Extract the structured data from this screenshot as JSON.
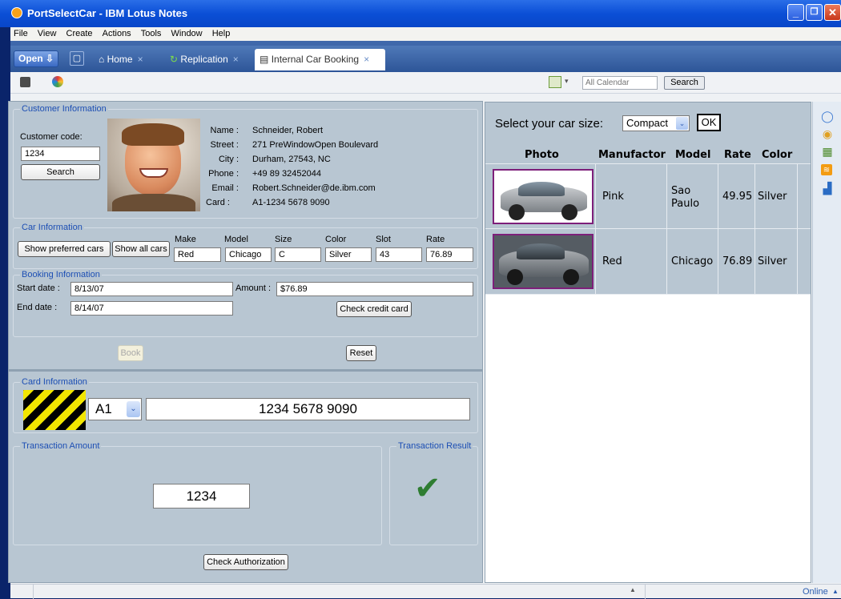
{
  "window": {
    "title": "PortSelectCar - IBM Lotus Notes",
    "controls": {
      "minimize": "_",
      "restore": "❐",
      "close": "✕"
    }
  },
  "menu": [
    "File",
    "View",
    "Create",
    "Actions",
    "Tools",
    "Window",
    "Help"
  ],
  "tabs": {
    "open_label": "Open",
    "items": [
      {
        "label": "Home",
        "close": "×"
      },
      {
        "label": "Replication",
        "close": "×"
      },
      {
        "label": "Internal Car Booking",
        "close": "×"
      }
    ]
  },
  "toolbar": {
    "calendar_placeholder": "All Calendar",
    "search_label": "Search"
  },
  "customer": {
    "legend": "Customer Information",
    "code_label": "Customer code:",
    "code_value": "1234",
    "search_label": "Search",
    "labels": [
      "Name :",
      "Street :",
      "City :",
      "Phone :",
      "Email :",
      "Card :"
    ],
    "values": [
      "Schneider, Robert",
      "271 PreWindowOpen Boulevard",
      "Durham, 27543, NC",
      "+49 89 32452044",
      "Robert.Schneider@de.ibm.com",
      "A1-1234 5678 9090"
    ]
  },
  "car": {
    "legend": "Car Information",
    "show_preferred": "Show preferred cars",
    "show_all": "Show all cars",
    "headers": [
      "Make",
      "Model",
      "Size",
      "Color",
      "Slot",
      "Rate"
    ],
    "values": [
      "Red",
      "Chicago",
      "C",
      "Silver",
      "43",
      "76.89"
    ]
  },
  "booking": {
    "legend": "Booking Information",
    "start_label": "Start date :",
    "start_value": "8/13/07",
    "end_label": "End date :",
    "end_value": "8/14/07",
    "amount_label": "Amount :",
    "amount_value": "$76.89",
    "check_credit": "Check credit card",
    "book": "Book",
    "reset": "Reset"
  },
  "card": {
    "legend": "Card Information",
    "type": "A1",
    "number": "1234 5678 9090",
    "tx_amount_legend": "Transaction Amount",
    "tx_amount": "1234",
    "tx_result_legend": "Transaction Result",
    "result_mark": "✔",
    "check_auth": "Check Authorization"
  },
  "selector": {
    "prompt": "Select your car size:",
    "size": "Compact",
    "ok": "OK",
    "columns": [
      "Photo",
      "Manufactor",
      "Model",
      "Rate",
      "Color"
    ],
    "rows": [
      {
        "manufactor": "Pink",
        "model": "Sao Paulo",
        "rate": "49.95",
        "color": "Silver"
      },
      {
        "manufactor": "Red",
        "model": "Chicago",
        "rate": "76.89",
        "color": "Silver"
      }
    ]
  },
  "status": {
    "online": "Online"
  },
  "colors": {
    "legend_text": "#1d4fb4",
    "check_green": "#2e7d32",
    "titlebar": "#0b4fd6"
  }
}
